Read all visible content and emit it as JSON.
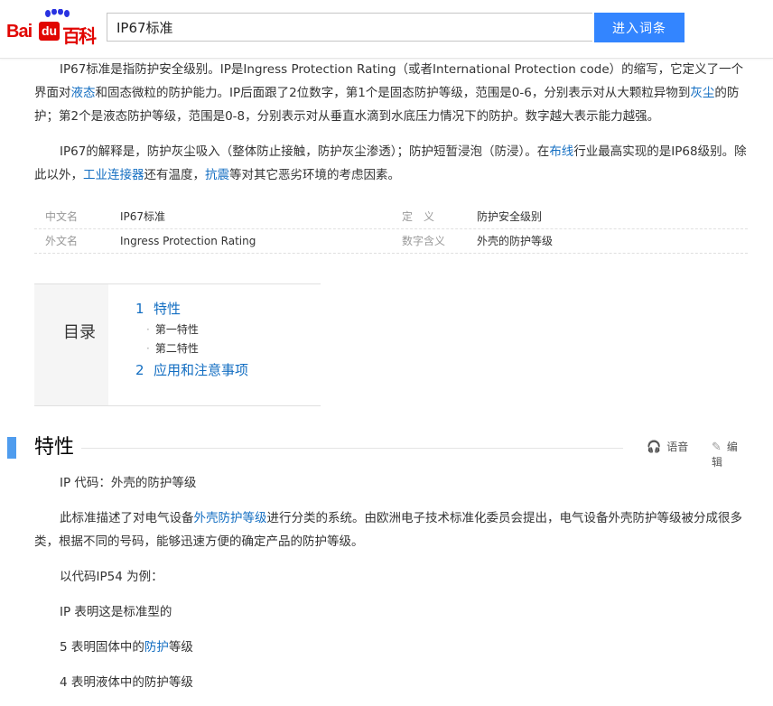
{
  "header": {
    "logo_bai": "Bai",
    "logo_du": "du",
    "logo_baike": "百科",
    "search_value": "IP67标准",
    "search_button": "进入词条"
  },
  "intro": {
    "p1": [
      {
        "t": "IP67标准是指防护安全级别。IP是Ingress Protection Rating（或者International Protection code）的缩写，它定义了一个界面对"
      },
      {
        "t": "液态",
        "link": true
      },
      {
        "t": "和固态微粒的防护能力。IP后面跟了2位数字，第1个是固态防护等级，范围是0-6，分别表示对从大颗粒异物到"
      },
      {
        "t": "灰尘",
        "link": true
      },
      {
        "t": "的防护；第2个是液态防护等级，范围是0-8，分别表示对从垂直水滴到水底压力情况下的防护。数字越大表示能力越强。"
      }
    ],
    "p2": [
      {
        "t": "IP67的解释是，防护灰尘吸入（整体防止接触，防护灰尘渗透）；防护短暂浸泡（防浸）。在"
      },
      {
        "t": "布线",
        "link": true
      },
      {
        "t": "行业最高实现的是IP68级别。除此以外，"
      },
      {
        "t": "工业连接器",
        "link": true
      },
      {
        "t": "还有温度，"
      },
      {
        "t": "抗震",
        "link": true
      },
      {
        "t": "等对其它恶劣环境的考虑因素。"
      }
    ]
  },
  "basic_info": [
    {
      "n1": "中文名",
      "v1": "IP67标准",
      "n2": "定　义",
      "v2": "防护安全级别"
    },
    {
      "n1": "外文名",
      "v1": "Ingress Protection Rating",
      "n2": "数字含义",
      "v2": "外壳的防护等级"
    }
  ],
  "toc": {
    "title": "目录",
    "items": [
      {
        "num": "1",
        "label": "特性",
        "children": [
          "第一特性",
          "第二特性"
        ]
      },
      {
        "num": "2",
        "label": "应用和注意事项",
        "children": []
      }
    ]
  },
  "section": {
    "title": "特性",
    "audio_label": "语音",
    "edit_label": "编辑",
    "paras": [
      [
        {
          "t": "IP 代码：外壳的防护等级"
        }
      ],
      [
        {
          "t": "此标准描述了对电气设备"
        },
        {
          "t": "外壳防护等级",
          "link": true
        },
        {
          "t": "进行分类的系统。由欧洲电子技术标准化委员会提出，电气设备外壳防护等级被分成很多类，根据不同的号码，能够迅速方便的确定产品的防护等级。"
        }
      ],
      [
        {
          "t": "以代码IP54 为例："
        }
      ],
      [
        {
          "t": "IP 表明这是标准型的"
        }
      ],
      [
        {
          "t": "5 表明固体中的"
        },
        {
          "t": "防护",
          "link": true
        },
        {
          "t": "等级"
        }
      ],
      [
        {
          "t": "4 表明液体中的防护等级"
        }
      ]
    ]
  }
}
